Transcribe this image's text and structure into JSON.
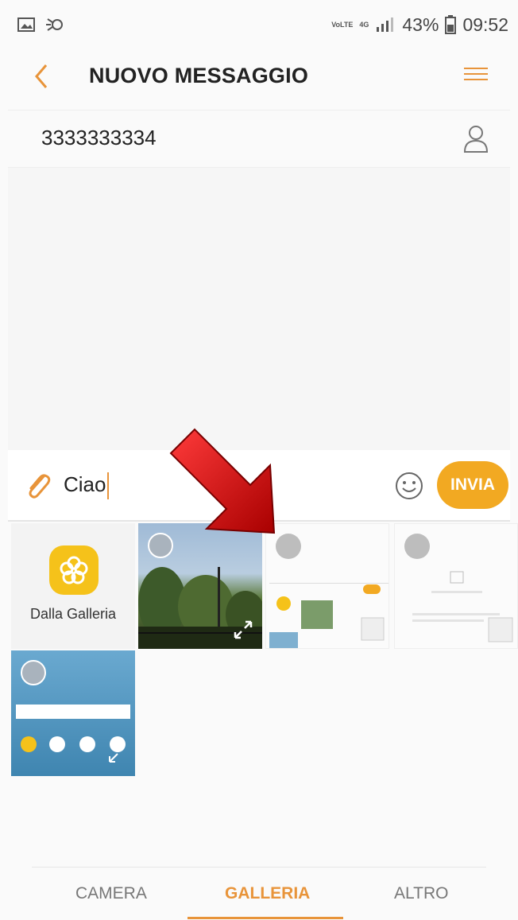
{
  "status_bar": {
    "network_volte": "VoLTE",
    "network_type": "4G",
    "battery": "43%",
    "time": "09:52"
  },
  "header": {
    "title": "NUOVO MESSAGGIO"
  },
  "recipient": {
    "number": "3333333334"
  },
  "composer": {
    "text": "Ciao",
    "send_label": "INVIA"
  },
  "gallery": {
    "from_gallery_label": "Dalla Galleria"
  },
  "tabs": [
    {
      "label": "CAMERA",
      "active": false
    },
    {
      "label": "GALLERIA",
      "active": true
    },
    {
      "label": "ALTRO",
      "active": false
    }
  ],
  "colors": {
    "accent": "#e8943a",
    "send_button": "#f2a922",
    "gallery_icon": "#f5c21a",
    "arrow": "#d0101a"
  }
}
